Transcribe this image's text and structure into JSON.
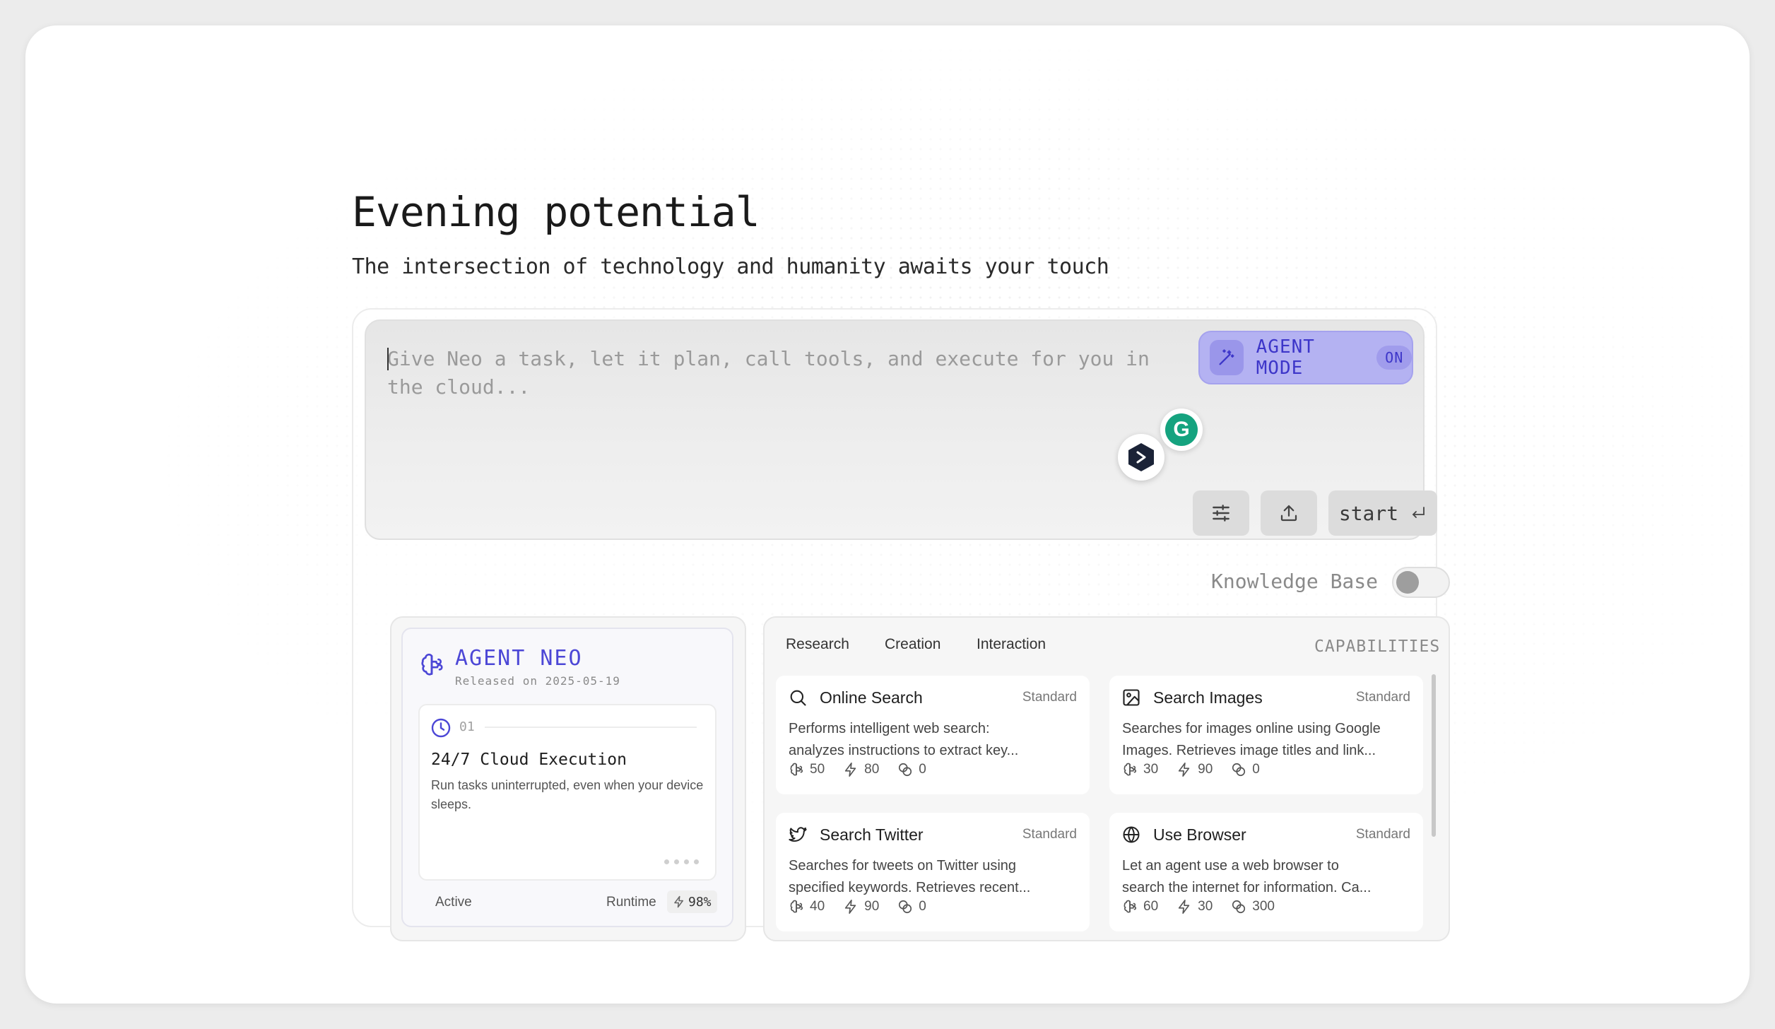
{
  "heading": {
    "title": "Evening potential",
    "subtitle": "The intersection of technology and humanity awaits your touch"
  },
  "prompt": {
    "placeholder": "Give Neo a task, let it plan, call tools, and execute for you in the cloud...",
    "agent_mode_label": "AGENT MODE",
    "agent_mode_state": "ON",
    "start_label": "start"
  },
  "knowledge_base": {
    "label": "Knowledge Base",
    "enabled": false
  },
  "agent": {
    "name": "AGENT NEO",
    "released": "Released on 2025-05-19",
    "feature": {
      "number": "01",
      "title": "24/7 Cloud Execution",
      "description": "Run tasks uninterrupted, even when your device sleeps."
    },
    "status": "Active",
    "runtime_label": "Runtime",
    "runtime_value": "98%"
  },
  "capabilities": {
    "tabs": [
      "Research",
      "Creation",
      "Interaction"
    ],
    "header": "CAPABILITIES",
    "cards": [
      {
        "name": "Online Search",
        "tier": "Standard",
        "icon": "search-icon",
        "desc1": "Performs intelligent web search:",
        "desc2": "analyzes instructions to extract key...",
        "brain": "50",
        "bolt": "80",
        "coins": "0"
      },
      {
        "name": "Search Images",
        "tier": "Standard",
        "icon": "image-icon",
        "desc1": "Searches for images online using Google",
        "desc2": "Images. Retrieves image titles and link...",
        "brain": "30",
        "bolt": "90",
        "coins": "0"
      },
      {
        "name": "Search Twitter",
        "tier": "Standard",
        "icon": "twitter-icon",
        "desc1": "Searches for tweets on Twitter using",
        "desc2": "specified keywords. Retrieves recent...",
        "brain": "40",
        "bolt": "90",
        "coins": "0"
      },
      {
        "name": "Use Browser",
        "tier": "Standard",
        "icon": "globe-icon",
        "desc1": "Let an agent use a web browser to",
        "desc2": "search the internet for information. Ca...",
        "brain": "60",
        "bolt": "30",
        "coins": "300"
      }
    ]
  },
  "colors": {
    "accent": "#4c47d6",
    "agent_mode_bg": "#b4b2f2",
    "background": "#ffffff"
  }
}
